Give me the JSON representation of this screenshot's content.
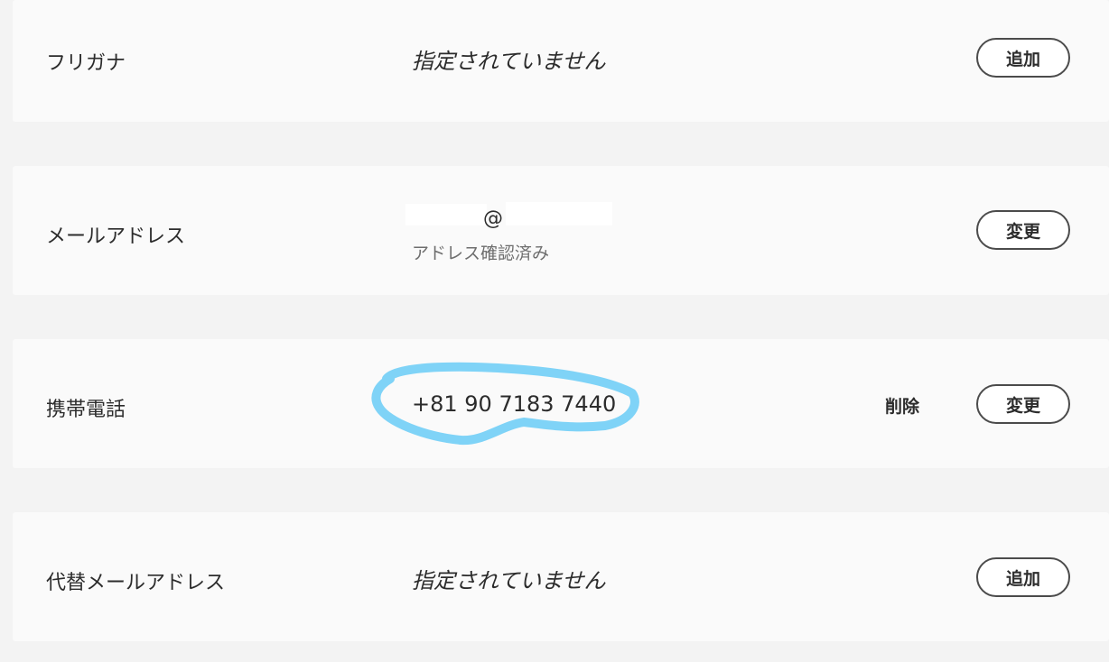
{
  "rows": [
    {
      "label": "フリガナ",
      "value": "指定されていません",
      "action": "追加"
    },
    {
      "label": "メールアドレス",
      "value_visible": "@",
      "status": "アドレス確認済み",
      "action": "変更"
    },
    {
      "label": "携帯電話",
      "value": "+81 90 7183 7440",
      "secondary_action": "削除",
      "action": "変更"
    },
    {
      "label": "代替メールアドレス",
      "value": "指定されていません",
      "action": "追加"
    }
  ],
  "colors": {
    "page_background": "#f3f3f3",
    "card_background": "#fafafa",
    "button_border": "#4b4b4b",
    "annotation_circle": "#7fd3f7"
  }
}
